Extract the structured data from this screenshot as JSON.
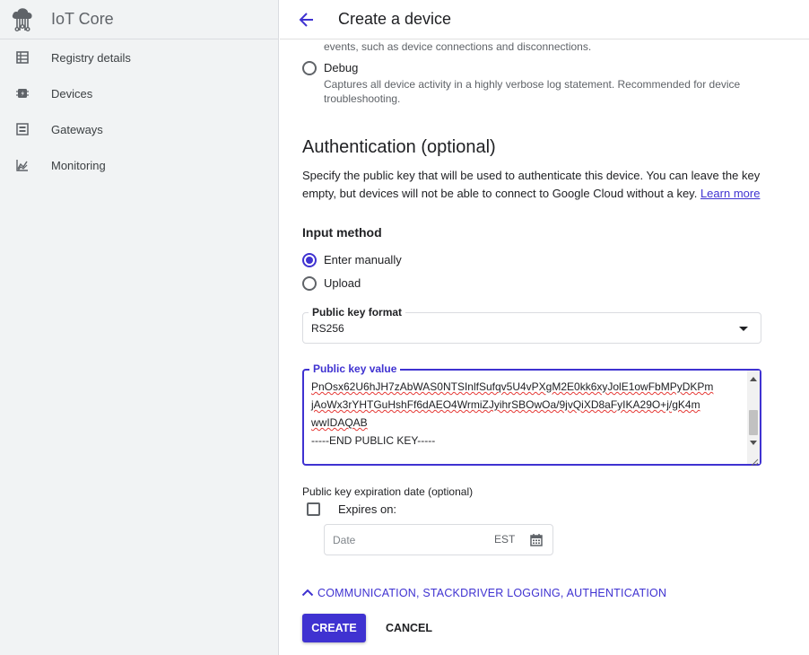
{
  "app": {
    "title": "IoT Core"
  },
  "sidebar": {
    "items": [
      {
        "label": "Registry details",
        "icon": "registry-icon"
      },
      {
        "label": "Devices",
        "icon": "chip-icon"
      },
      {
        "label": "Gateways",
        "icon": "gateway-icon"
      },
      {
        "label": "Monitoring",
        "icon": "chart-icon"
      }
    ]
  },
  "header": {
    "title": "Create a device"
  },
  "logging": {
    "prev_desc_tail": "events, such as device connections and disconnections.",
    "debug_label": "Debug",
    "debug_desc_line1": "Captures all device activity in a highly verbose log statement. Recommended for device",
    "debug_desc_line2": "troubleshooting."
  },
  "auth": {
    "title": "Authentication (optional)",
    "description": "Specify the public key that will be used to authenticate this device. You can leave the key empty, but devices will not be able to connect to Google Cloud without a key.",
    "learn_more": "Learn more",
    "input_method_title": "Input method",
    "options": [
      {
        "label": "Enter manually",
        "selected": true
      },
      {
        "label": "Upload",
        "selected": false
      }
    ],
    "key_format_label": "Public key format",
    "key_format_value": "RS256",
    "key_value_label": "Public key value",
    "key_value_lines": [
      "PnOsx62U6hJH7zAbWAS0NTSInlfSufqv5U4vPXgM2E0kk6xyJolE1owFbMPyDKPm",
      "jAoWx3rYHTGuHshFf6dAEO4WrmiZJyihrSBOwOa/9jvQiXD8aFyIKA29O+j/gK4m",
      "wwIDAQAB",
      "-----END PUBLIC KEY-----"
    ],
    "expiration_title": "Public key expiration date (optional)",
    "expires_label": "Expires on:",
    "expires_checked": false,
    "date_placeholder": "Date",
    "timezone": "EST"
  },
  "advanced_toggle": "COMMUNICATION, STACKDRIVER LOGGING, AUTHENTICATION",
  "actions": {
    "create": "CREATE",
    "cancel": "CANCEL"
  },
  "colors": {
    "accent": "#3f32d1",
    "sidebar_bg": "#f1f3f4",
    "text": "#202124",
    "muted": "#5f6368"
  }
}
